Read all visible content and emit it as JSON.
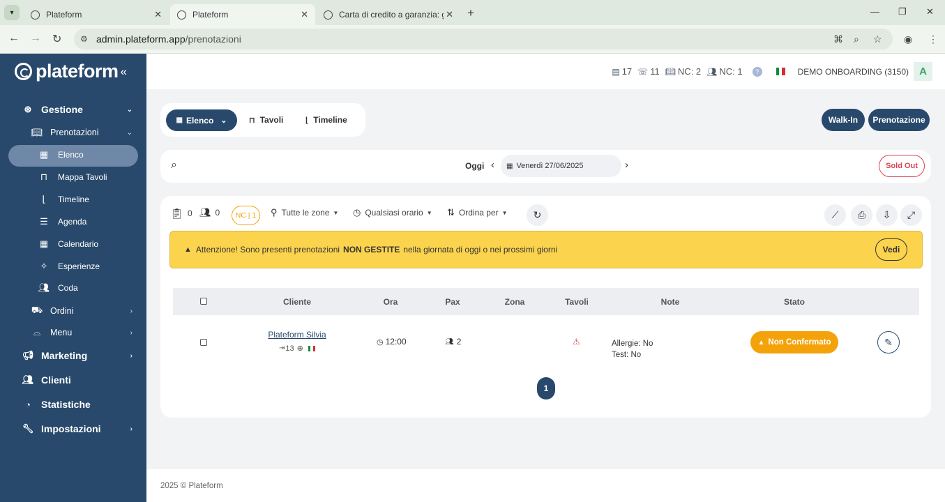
{
  "browser": {
    "tabs": [
      {
        "label": "Plateform"
      },
      {
        "label": "Plateform"
      },
      {
        "label": "Carta di credito a garanzia: guid"
      }
    ],
    "url_host": "admin.plateform.app",
    "url_path": "/prenotazioni"
  },
  "sidebar": {
    "logo": "plateform",
    "items": [
      {
        "label": "Gestione"
      },
      {
        "label": "Prenotazioni"
      },
      {
        "label": "Elenco"
      },
      {
        "label": "Mappa Tavoli"
      },
      {
        "label": "Timeline"
      },
      {
        "label": "Agenda"
      },
      {
        "label": "Calendario"
      },
      {
        "label": "Esperienze"
      },
      {
        "label": "Coda"
      },
      {
        "label": "Ordini"
      },
      {
        "label": "Menu"
      },
      {
        "label": "Marketing"
      },
      {
        "label": "Clienti"
      },
      {
        "label": "Statistiche"
      },
      {
        "label": "Impostazioni"
      }
    ]
  },
  "topbar": {
    "stat1": "17",
    "stat2": "11",
    "stat3": "NC: 2",
    "stat4": "NC: 1",
    "help": "?",
    "account": "DEMO ONBOARDING (3150)",
    "avatar": "A"
  },
  "views": {
    "elenco": "Elenco",
    "tavoli": "Tavoli",
    "timeline": "Timeline",
    "walkin": "Walk-In",
    "prenotazione": "Prenotazione"
  },
  "datebar": {
    "oggi": "Oggi",
    "date": "Venerdì 27/06/2025",
    "soldout": "Sold Out"
  },
  "filters": {
    "count1": "0",
    "count2": "0",
    "nc": "NC | 1",
    "zone": "Tutte le zone",
    "orario": "Qualsiasi orario",
    "ordina": "Ordina per"
  },
  "alert": {
    "pre": "Attenzione! Sono presenti prenotazioni",
    "bold": "NON GESTITE",
    "post": "nella giornata di oggi o nei prossimi giorni",
    "button": "Vedi"
  },
  "table": {
    "headers": [
      "Cliente",
      "Ora",
      "Pax",
      "Zona",
      "Tavoli",
      "Note",
      "Stato"
    ],
    "rows": [
      {
        "cliente": "Plateform Silvia",
        "visits": "13",
        "ora": "12:00",
        "pax": "2",
        "note1": "Allergie: No",
        "note2": "Test: No",
        "stato": "Non Confermato"
      }
    ]
  },
  "pagination": {
    "current": "1"
  },
  "footer": "2025 © Plateform",
  "colors": {
    "sidebar": "#28496b",
    "accent_dark": "#28496b",
    "alert": "#fcd34d",
    "status_warning": "#f4a20a",
    "soldout": "#d9434f"
  }
}
